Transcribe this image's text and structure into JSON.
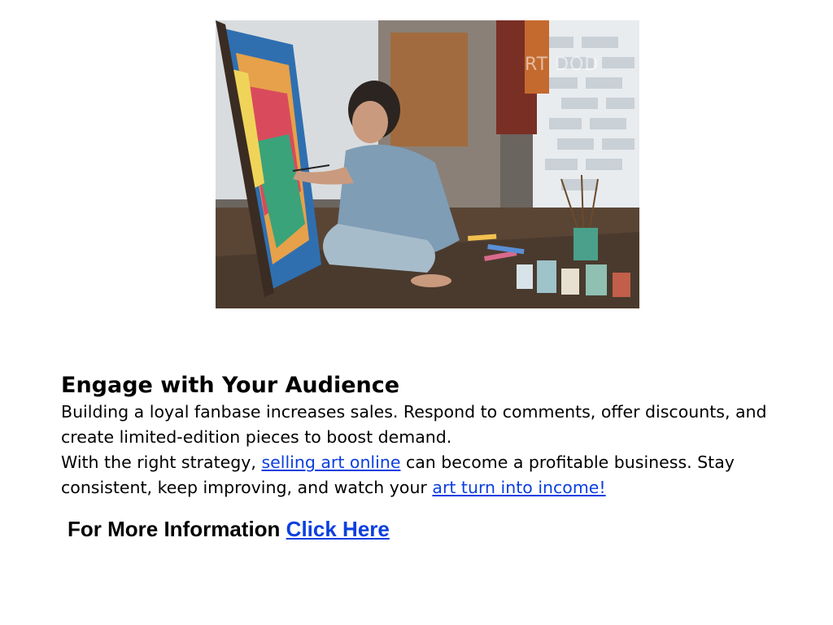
{
  "image": {
    "alt": "Woman painting a colorful canvas on the floor of an art studio",
    "watermark": "RT DOD"
  },
  "section": {
    "heading": "Engage with Your Audience",
    "paragraph1": "Building a loyal fanbase increases sales. Respond to comments, offer discounts, and create limited-edition pieces to boost demand.",
    "paragraph2_before": "With the right strategy, ",
    "paragraph2_link1": "selling art online",
    "paragraph2_middle": " can become a profitable business. Stay consistent, keep improving, and watch your ",
    "paragraph2_link2": "art turn into income!"
  },
  "cta": {
    "label": "For More Information ",
    "link": "Click Here"
  },
  "colors": {
    "link": "#0b3fe0",
    "text": "#000000",
    "background": "#ffffff"
  }
}
